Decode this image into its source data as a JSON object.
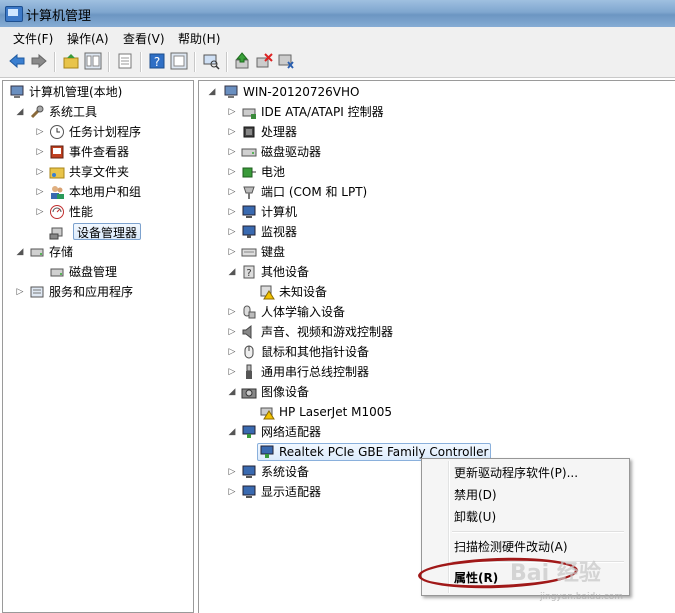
{
  "window": {
    "title": "计算机管理"
  },
  "menu": {
    "file": "文件(F)",
    "action": "操作(A)",
    "view": "查看(V)",
    "help": "帮助(H)"
  },
  "toolbar": {
    "icons": [
      "back-arrow-icon",
      "forward-arrow-icon",
      "up-folder-icon",
      "show-hide-tree-icon",
      "export-list-icon",
      "help-icon",
      "help-topics-icon",
      "scan-hardware-icon",
      "update-driver-icon",
      "uninstall-icon",
      "disable-icon"
    ]
  },
  "tree": {
    "root": "计算机管理(本地)",
    "system_tools": "系统工具",
    "task_scheduler": "任务计划程序",
    "event_viewer": "事件查看器",
    "shared_folders": "共享文件夹",
    "local_users": "本地用户和组",
    "performance": "性能",
    "device_manager": "设备管理器",
    "storage": "存储",
    "disk_management": "磁盘管理",
    "services_apps": "服务和应用程序"
  },
  "devices": {
    "computer_name": "WIN-20120726VHO",
    "items": [
      "IDE ATA/ATAPI 控制器",
      "处理器",
      "磁盘驱动器",
      "电池",
      "端口 (COM 和 LPT)",
      "计算机",
      "监视器",
      "键盘",
      "其他设备",
      "未知设备",
      "人体学输入设备",
      "声音、视频和游戏控制器",
      "鼠标和其他指针设备",
      "通用串行总线控制器",
      "图像设备",
      "HP LaserJet M1005",
      "网络适配器",
      "Realtek PCIe GBE Family Controller",
      "系统设备",
      "显示适配器"
    ]
  },
  "context_menu": {
    "update_driver": "更新驱动程序软件(P)...",
    "disable": "禁用(D)",
    "uninstall": "卸载(U)",
    "scan": "扫描检测硬件改动(A)",
    "properties": "属性(R)"
  },
  "watermark": {
    "main": "Bai 经验",
    "sub": "jingyan.baidu.com"
  }
}
